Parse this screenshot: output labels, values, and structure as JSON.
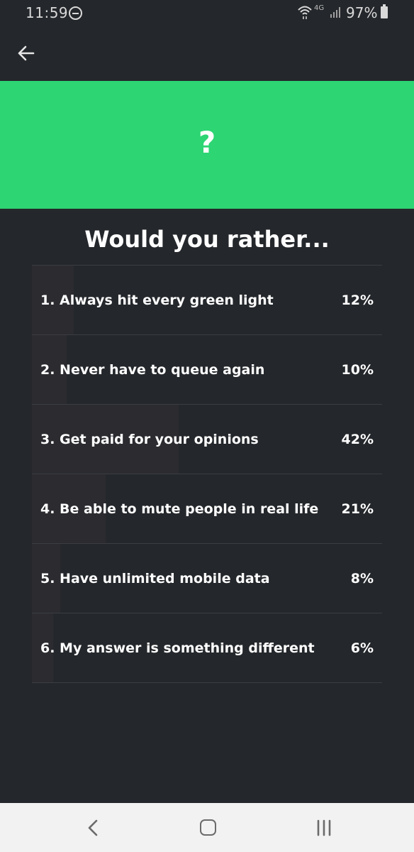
{
  "status_bar": {
    "time": "11:59",
    "network": "4G",
    "battery": "97%",
    "icons": [
      "do-not-disturb-icon",
      "wifi-icon",
      "signal-icon",
      "battery-icon"
    ]
  },
  "app_bar": {
    "back_icon": "arrow-left-icon"
  },
  "hero": {
    "mark": "?",
    "color": "#2dd573"
  },
  "question": {
    "title": "Would you rather..."
  },
  "options": [
    {
      "label": "1.  Always hit every green light",
      "percent": "12%",
      "share": 0.12
    },
    {
      "label": "2.  Never have to queue again",
      "percent": "10%",
      "share": 0.1
    },
    {
      "label": "3.  Get paid for your opinions",
      "percent": "42%",
      "share": 0.42
    },
    {
      "label": "4.  Be able to mute people in real life",
      "percent": "21%",
      "share": 0.21
    },
    {
      "label": "5.  Have unlimited mobile data",
      "percent": "8%",
      "share": 0.08
    },
    {
      "label": "6.  My answer is something different",
      "percent": "6%",
      "share": 0.06
    }
  ],
  "nav_bar": {
    "icons": [
      "nav-back-icon",
      "home-icon",
      "recents-icon"
    ]
  },
  "colors": {
    "background": "#24272b",
    "accent": "#2dd573",
    "nav_bar": "#f2f2f2"
  }
}
